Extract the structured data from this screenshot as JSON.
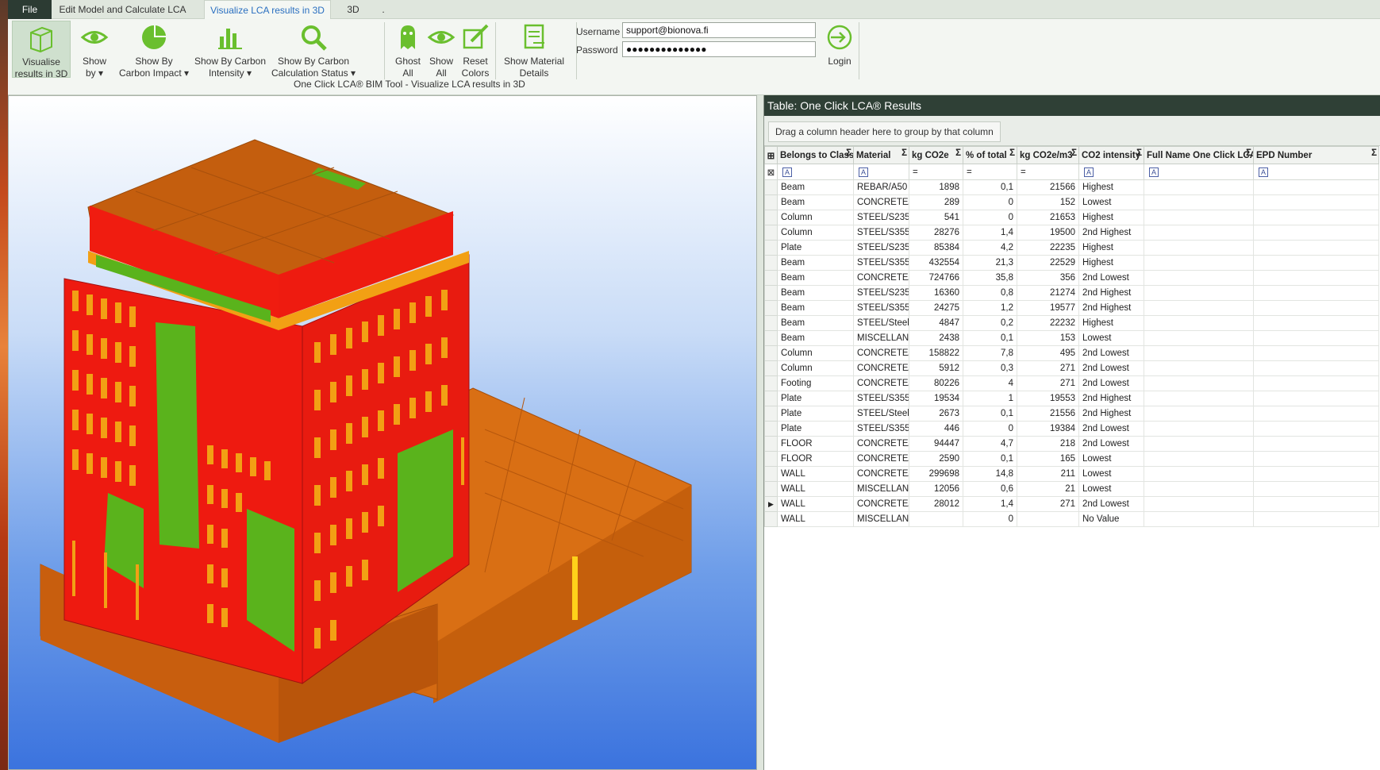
{
  "tabs": [
    {
      "label": "File"
    },
    {
      "label": "Edit Model and Calculate LCA"
    },
    {
      "label": "Visualize LCA results in 3D"
    },
    {
      "label": "3D"
    },
    {
      "label": "."
    }
  ],
  "ribbon": {
    "visualise": "Visualise\nresults in 3D",
    "show_by": "Show\nby ▾",
    "show_by_carbon_impact": "Show By\nCarbon Impact ▾",
    "show_by_carbon_intensity": "Show By Carbon\nIntensity ▾",
    "show_by_calc_status": "Show By Carbon\nCalculation Status ▾",
    "ghost_all": "Ghost\nAll",
    "show_all": "Show\nAll",
    "reset_colors": "Reset\nColors",
    "show_material_details": "Show Material\nDetails",
    "caption": "One Click LCA® BIM Tool - Visualize LCA results in 3D",
    "username_label": "Username",
    "username_value": "support@bionova.fi",
    "password_label": "Password",
    "password_value": "●●●●●●●●●●●●●●",
    "login": "Login"
  },
  "panel": {
    "title": "Table: One Click LCA® Results",
    "group_hint": "Drag a column header here to group by that column",
    "columns": [
      "Belongs to Class",
      "Material",
      "kg CO2e",
      "% of total",
      "kg CO2e/m3",
      "CO2 intensity",
      "Full Name One Click LCA",
      "EPD Number"
    ],
    "rows": [
      [
        "Beam",
        "REBAR/A50",
        "1898",
        "0,1",
        "21566",
        "Highest",
        "",
        ""
      ],
      [
        "Beam",
        "CONCRETE/",
        "289",
        "0",
        "152",
        "Lowest",
        "",
        ""
      ],
      [
        "Column",
        "STEEL/S235",
        "541",
        "0",
        "21653",
        "Highest",
        "",
        ""
      ],
      [
        "Column",
        "STEEL/S355",
        "28276",
        "1,4",
        "19500",
        "2nd Highest",
        "",
        ""
      ],
      [
        "Plate",
        "STEEL/S235",
        "85384",
        "4,2",
        "22235",
        "Highest",
        "",
        ""
      ],
      [
        "Beam",
        "STEEL/S355",
        "432554",
        "21,3",
        "22529",
        "Highest",
        "",
        ""
      ],
      [
        "Beam",
        "CONCRETE/",
        "724766",
        "35,8",
        "356",
        "2nd Lowest",
        "",
        ""
      ],
      [
        "Beam",
        "STEEL/S235",
        "16360",
        "0,8",
        "21274",
        "2nd Highest",
        "",
        ""
      ],
      [
        "Beam",
        "STEEL/S355",
        "24275",
        "1,2",
        "19577",
        "2nd Highest",
        "",
        ""
      ],
      [
        "Beam",
        "STEEL/Steel",
        "4847",
        "0,2",
        "22232",
        "Highest",
        "",
        ""
      ],
      [
        "Beam",
        "MISCELLAN",
        "2438",
        "0,1",
        "153",
        "Lowest",
        "",
        ""
      ],
      [
        "Column",
        "CONCRETE/",
        "158822",
        "7,8",
        "495",
        "2nd Lowest",
        "",
        ""
      ],
      [
        "Column",
        "CONCRETE/",
        "5912",
        "0,3",
        "271",
        "2nd Lowest",
        "",
        ""
      ],
      [
        "Footing",
        "CONCRETE/",
        "80226",
        "4",
        "271",
        "2nd Lowest",
        "",
        ""
      ],
      [
        "Plate",
        "STEEL/S355",
        "19534",
        "1",
        "19553",
        "2nd Highest",
        "",
        ""
      ],
      [
        "Plate",
        "STEEL/Steel",
        "2673",
        "0,1",
        "21556",
        "2nd Highest",
        "",
        ""
      ],
      [
        "Plate",
        "STEEL/S355",
        "446",
        "0",
        "19384",
        "2nd Lowest",
        "",
        ""
      ],
      [
        "FLOOR",
        "CONCRETE/",
        "94447",
        "4,7",
        "218",
        "2nd Lowest",
        "",
        ""
      ],
      [
        "FLOOR",
        "CONCRETE/",
        "2590",
        "0,1",
        "165",
        "Lowest",
        "",
        ""
      ],
      [
        "WALL",
        "CONCRETE/",
        "299698",
        "14,8",
        "211",
        "Lowest",
        "",
        ""
      ],
      [
        "WALL",
        "MISCELLAN",
        "12056",
        "0,6",
        "21",
        "Lowest",
        "",
        ""
      ],
      [
        "WALL",
        "CONCRETE/",
        "28012",
        "1,4",
        "271",
        "2nd Lowest",
        "",
        ""
      ],
      [
        "WALL",
        "MISCELLAN",
        "",
        "0",
        "",
        "No Value",
        "",
        ""
      ]
    ],
    "selected_row": 21
  },
  "colors": {
    "highest": "#ff0000",
    "mid": "#d4690a",
    "lowest": "#58b81a",
    "accent": "#2a6fc0"
  }
}
